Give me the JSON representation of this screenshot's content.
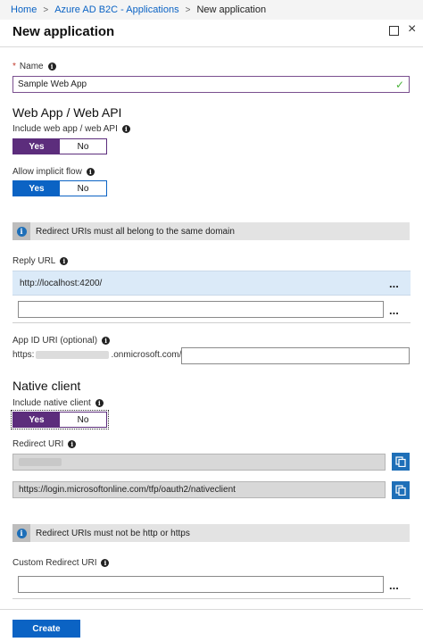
{
  "breadcrumb": {
    "home": "Home",
    "b2c": "Azure AD B2C - Applications",
    "current": "New application",
    "sep": ">"
  },
  "blade": {
    "title": "New application",
    "close": "×"
  },
  "name": {
    "required_mark": "*",
    "label": "Name",
    "value": "Sample Web App",
    "valid_mark": "✓"
  },
  "web": {
    "heading": "Web App / Web API",
    "include_label": "Include web app / web API",
    "include_yes": "Yes",
    "include_no": "No",
    "include_selected": "Yes",
    "implicit_label": "Allow implicit flow",
    "implicit_yes": "Yes",
    "implicit_no": "No",
    "implicit_selected": "Yes"
  },
  "banner1": {
    "text": "Redirect URIs must all belong to the same domain"
  },
  "reply": {
    "label": "Reply URL",
    "url_1": "http://localhost:4200/",
    "url_2": "",
    "more": "..."
  },
  "appid": {
    "label": "App ID URI (optional)",
    "prefix": "https:",
    "suffix": ".onmicrosoft.com/",
    "value": ""
  },
  "native": {
    "heading": "Native client",
    "include_label": "Include native client",
    "yes": "Yes",
    "no": "No",
    "selected": "Yes",
    "redirect_label": "Redirect URI",
    "redirect_2": "https://login.microsoftonline.com/tfp/oauth2/nativeclient"
  },
  "banner2": {
    "text": "Redirect URIs must not be http or https"
  },
  "custom": {
    "label": "Custom Redirect URI",
    "value": "",
    "more": "..."
  },
  "icons": {
    "info": "i",
    "copy": "copy-icon",
    "maximize": "maximize-icon",
    "close": "close-icon",
    "check": "checkmark-icon"
  },
  "colors": {
    "purple_toggle": "#5c2d7c",
    "blue_toggle": "#0b63c4",
    "link": "#0b63c4",
    "banner": "#e3e3e3",
    "selected_row": "#dbeaf8"
  },
  "actions": {
    "create": "Create"
  }
}
